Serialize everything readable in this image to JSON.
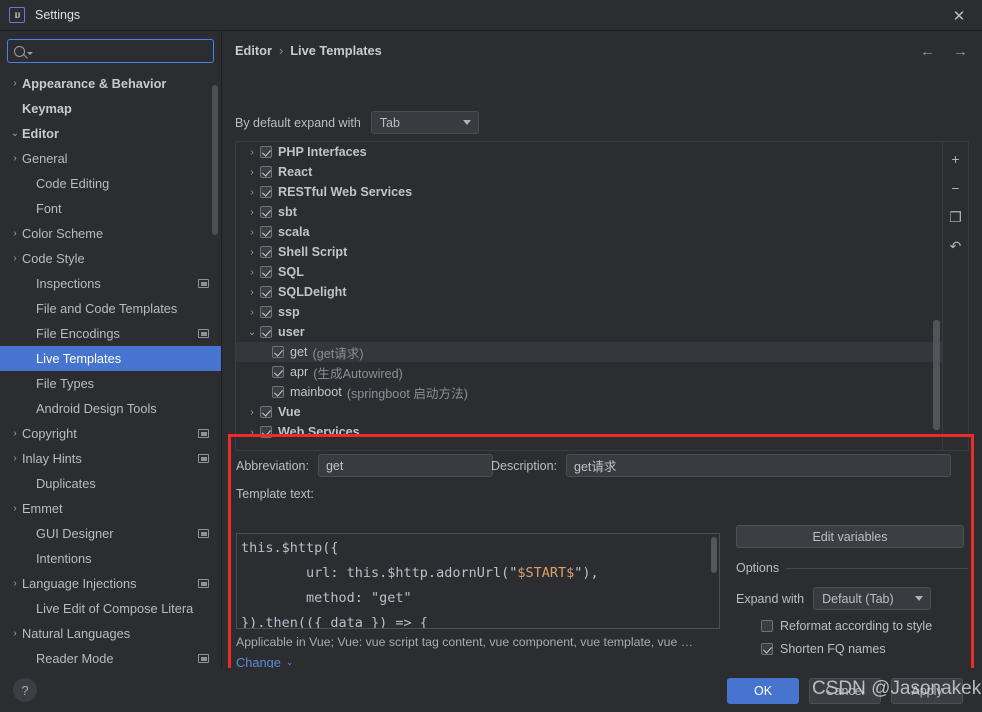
{
  "window": {
    "title": "Settings",
    "logo_text": "IJ",
    "close_icon": "close-icon"
  },
  "sidebar": {
    "search": {
      "value": "",
      "placeholder": ""
    },
    "items": [
      {
        "label": "Appearance & Behavior",
        "arrow": "›",
        "bold": true,
        "indent": 8,
        "badge": false,
        "selected": false
      },
      {
        "label": "Keymap",
        "arrow": "",
        "bold": true,
        "indent": 22,
        "badge": false,
        "selected": false
      },
      {
        "label": "Editor",
        "arrow": "⌄",
        "bold": true,
        "indent": 8,
        "badge": false,
        "selected": false
      },
      {
        "label": "General",
        "arrow": "›",
        "bold": false,
        "indent": 22,
        "badge": false,
        "selected": false
      },
      {
        "label": "Code Editing",
        "arrow": "",
        "bold": false,
        "indent": 36,
        "badge": false,
        "selected": false
      },
      {
        "label": "Font",
        "arrow": "",
        "bold": false,
        "indent": 36,
        "badge": false,
        "selected": false
      },
      {
        "label": "Color Scheme",
        "arrow": "›",
        "bold": false,
        "indent": 22,
        "badge": false,
        "selected": false
      },
      {
        "label": "Code Style",
        "arrow": "›",
        "bold": false,
        "indent": 22,
        "badge": false,
        "selected": false
      },
      {
        "label": "Inspections",
        "arrow": "",
        "bold": false,
        "indent": 36,
        "badge": true,
        "selected": false
      },
      {
        "label": "File and Code Templates",
        "arrow": "",
        "bold": false,
        "indent": 36,
        "badge": false,
        "selected": false
      },
      {
        "label": "File Encodings",
        "arrow": "",
        "bold": false,
        "indent": 36,
        "badge": true,
        "selected": false
      },
      {
        "label": "Live Templates",
        "arrow": "",
        "bold": false,
        "indent": 36,
        "badge": false,
        "selected": true
      },
      {
        "label": "File Types",
        "arrow": "",
        "bold": false,
        "indent": 36,
        "badge": false,
        "selected": false
      },
      {
        "label": "Android Design Tools",
        "arrow": "",
        "bold": false,
        "indent": 36,
        "badge": false,
        "selected": false
      },
      {
        "label": "Copyright",
        "arrow": "›",
        "bold": false,
        "indent": 22,
        "badge": true,
        "selected": false
      },
      {
        "label": "Inlay Hints",
        "arrow": "›",
        "bold": false,
        "indent": 22,
        "badge": true,
        "selected": false
      },
      {
        "label": "Duplicates",
        "arrow": "",
        "bold": false,
        "indent": 36,
        "badge": false,
        "selected": false
      },
      {
        "label": "Emmet",
        "arrow": "›",
        "bold": false,
        "indent": 22,
        "badge": false,
        "selected": false
      },
      {
        "label": "GUI Designer",
        "arrow": "",
        "bold": false,
        "indent": 36,
        "badge": true,
        "selected": false
      },
      {
        "label": "Intentions",
        "arrow": "",
        "bold": false,
        "indent": 36,
        "badge": false,
        "selected": false
      },
      {
        "label": "Language Injections",
        "arrow": "›",
        "bold": false,
        "indent": 22,
        "badge": true,
        "selected": false
      },
      {
        "label": "Live Edit of Compose Litera",
        "arrow": "",
        "bold": false,
        "indent": 36,
        "badge": false,
        "selected": false
      },
      {
        "label": "Natural Languages",
        "arrow": "›",
        "bold": false,
        "indent": 22,
        "badge": false,
        "selected": false
      },
      {
        "label": "Reader Mode",
        "arrow": "",
        "bold": false,
        "indent": 36,
        "badge": true,
        "selected": false
      }
    ]
  },
  "breadcrumb": {
    "parent": "Editor",
    "separator": "›",
    "current": "Live Templates",
    "back_icon": "arrow-left-icon",
    "forward_icon": "arrow-right-icon",
    "back_glyph": "←",
    "forward_glyph": "→"
  },
  "expand_row": {
    "label": "By default expand with",
    "value": "Tab"
  },
  "templates_tree": {
    "rows": [
      {
        "arrow": "›",
        "checked": true,
        "name": "PHP Interfaces",
        "desc": "",
        "child": false,
        "selected": false
      },
      {
        "arrow": "›",
        "checked": true,
        "name": "React",
        "desc": "",
        "child": false,
        "selected": false
      },
      {
        "arrow": "›",
        "checked": true,
        "name": "RESTful Web Services",
        "desc": "",
        "child": false,
        "selected": false
      },
      {
        "arrow": "›",
        "checked": true,
        "name": "sbt",
        "desc": "",
        "child": false,
        "selected": false
      },
      {
        "arrow": "›",
        "checked": true,
        "name": "scala",
        "desc": "",
        "child": false,
        "selected": false
      },
      {
        "arrow": "›",
        "checked": true,
        "name": "Shell Script",
        "desc": "",
        "child": false,
        "selected": false
      },
      {
        "arrow": "›",
        "checked": true,
        "name": "SQL",
        "desc": "",
        "child": false,
        "selected": false
      },
      {
        "arrow": "›",
        "checked": true,
        "name": "SQLDelight",
        "desc": "",
        "child": false,
        "selected": false
      },
      {
        "arrow": "›",
        "checked": true,
        "name": "ssp",
        "desc": "",
        "child": false,
        "selected": false
      },
      {
        "arrow": "⌄",
        "checked": true,
        "name": "user",
        "desc": "",
        "child": false,
        "selected": false
      },
      {
        "arrow": "",
        "checked": true,
        "name": "get",
        "desc": "(get请求)",
        "child": true,
        "selected": true
      },
      {
        "arrow": "",
        "checked": true,
        "name": "apr",
        "desc": "(生成Autowired)",
        "child": true,
        "selected": false
      },
      {
        "arrow": "",
        "checked": true,
        "name": "mainboot",
        "desc": "(springboot 启动方法)",
        "child": true,
        "selected": false
      },
      {
        "arrow": "›",
        "checked": true,
        "name": "Vue",
        "desc": "",
        "child": false,
        "selected": false
      },
      {
        "arrow": "›",
        "checked": true,
        "name": "Web Services",
        "desc": "",
        "child": false,
        "selected": false
      }
    ],
    "toolbar": [
      {
        "name": "add-template-button",
        "glyph": "+"
      },
      {
        "name": "remove-template-button",
        "glyph": "−"
      },
      {
        "name": "duplicate-template-button",
        "glyph": "❐"
      },
      {
        "name": "revert-template-button",
        "glyph": "↶"
      }
    ]
  },
  "detail": {
    "abbreviation_label": "Abbreviation:",
    "abbreviation_value": "get",
    "description_label": "Description:",
    "description_value": "get请求",
    "template_text_label": "Template text:",
    "code_lines": [
      {
        "prefix": "this.$http({",
        "var": "",
        "suffix": ""
      },
      {
        "prefix": "        url: this.$http.adornUrl(\"",
        "var": "$START$",
        "suffix": "\"),"
      },
      {
        "prefix": "        method: \"get\"",
        "var": "",
        "suffix": ""
      },
      {
        "prefix": "}).then(({ data }) => {",
        "var": "",
        "suffix": ""
      }
    ],
    "applicable_text": "Applicable in Vue; Vue: vue script tag content, vue component, vue template, vue …",
    "change_label": "Change",
    "change_chevron": "⌄",
    "edit_variables_label": "Edit variables",
    "options_title": "Options",
    "expand_with_label": "Expand with",
    "expand_with_value": "Default (Tab)",
    "reformat_label": "Reformat according to style",
    "reformat_checked": false,
    "shorten_label": "Shorten FQ names",
    "shorten_checked": true
  },
  "footer": {
    "help_glyph": "?",
    "ok_label": "OK",
    "cancel_label": "Cancel",
    "apply_label": "Apply"
  },
  "watermark": {
    "text": "CSDN @Jasonakeke"
  },
  "colors": {
    "background": "#2b2d30",
    "accent": "#4774cf",
    "annotation": "#ee2b2b",
    "link": "#5e8ad4",
    "variable_token": "#d9a06a"
  }
}
